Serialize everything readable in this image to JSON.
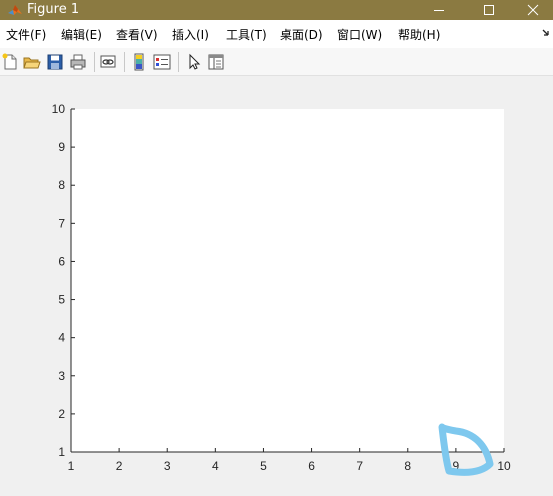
{
  "window": {
    "title": "Figure 1"
  },
  "menu": {
    "items": [
      "文件(F)",
      "编辑(E)",
      "查看(V)",
      "插入(I)",
      "工具(T)",
      "桌面(D)",
      "窗口(W)",
      "帮助(H)"
    ]
  },
  "toolbar": {
    "buttons": [
      {
        "name": "new-figure-icon"
      },
      {
        "name": "open-file-icon"
      },
      {
        "name": "save-figure-icon"
      },
      {
        "name": "print-figure-icon"
      },
      {
        "name": "link-plot-icon"
      },
      {
        "name": "insert-colorbar-icon"
      },
      {
        "name": "insert-legend-icon"
      },
      {
        "name": "edit-plot-cursor-icon"
      },
      {
        "name": "property-inspector-icon"
      }
    ]
  },
  "colors": {
    "titlebar": "#8b7a41",
    "annotation_stroke": "#7ec8ee"
  },
  "chart_data": {
    "type": "line",
    "xlim": [
      1,
      10
    ],
    "ylim": [
      1,
      10
    ],
    "x_ticks": [
      1,
      2,
      3,
      4,
      5,
      6,
      7,
      8,
      9,
      10
    ],
    "y_ticks": [
      1,
      2,
      3,
      4,
      5,
      6,
      7,
      8,
      9,
      10
    ],
    "x_tick_labels": [
      "1",
      "2",
      "3",
      "4",
      "5",
      "6",
      "7",
      "8",
      "9",
      "10"
    ],
    "y_tick_labels": [
      "1",
      "2",
      "3",
      "4",
      "5",
      "6",
      "7",
      "8",
      "9",
      "10"
    ],
    "grid": false,
    "series": []
  }
}
